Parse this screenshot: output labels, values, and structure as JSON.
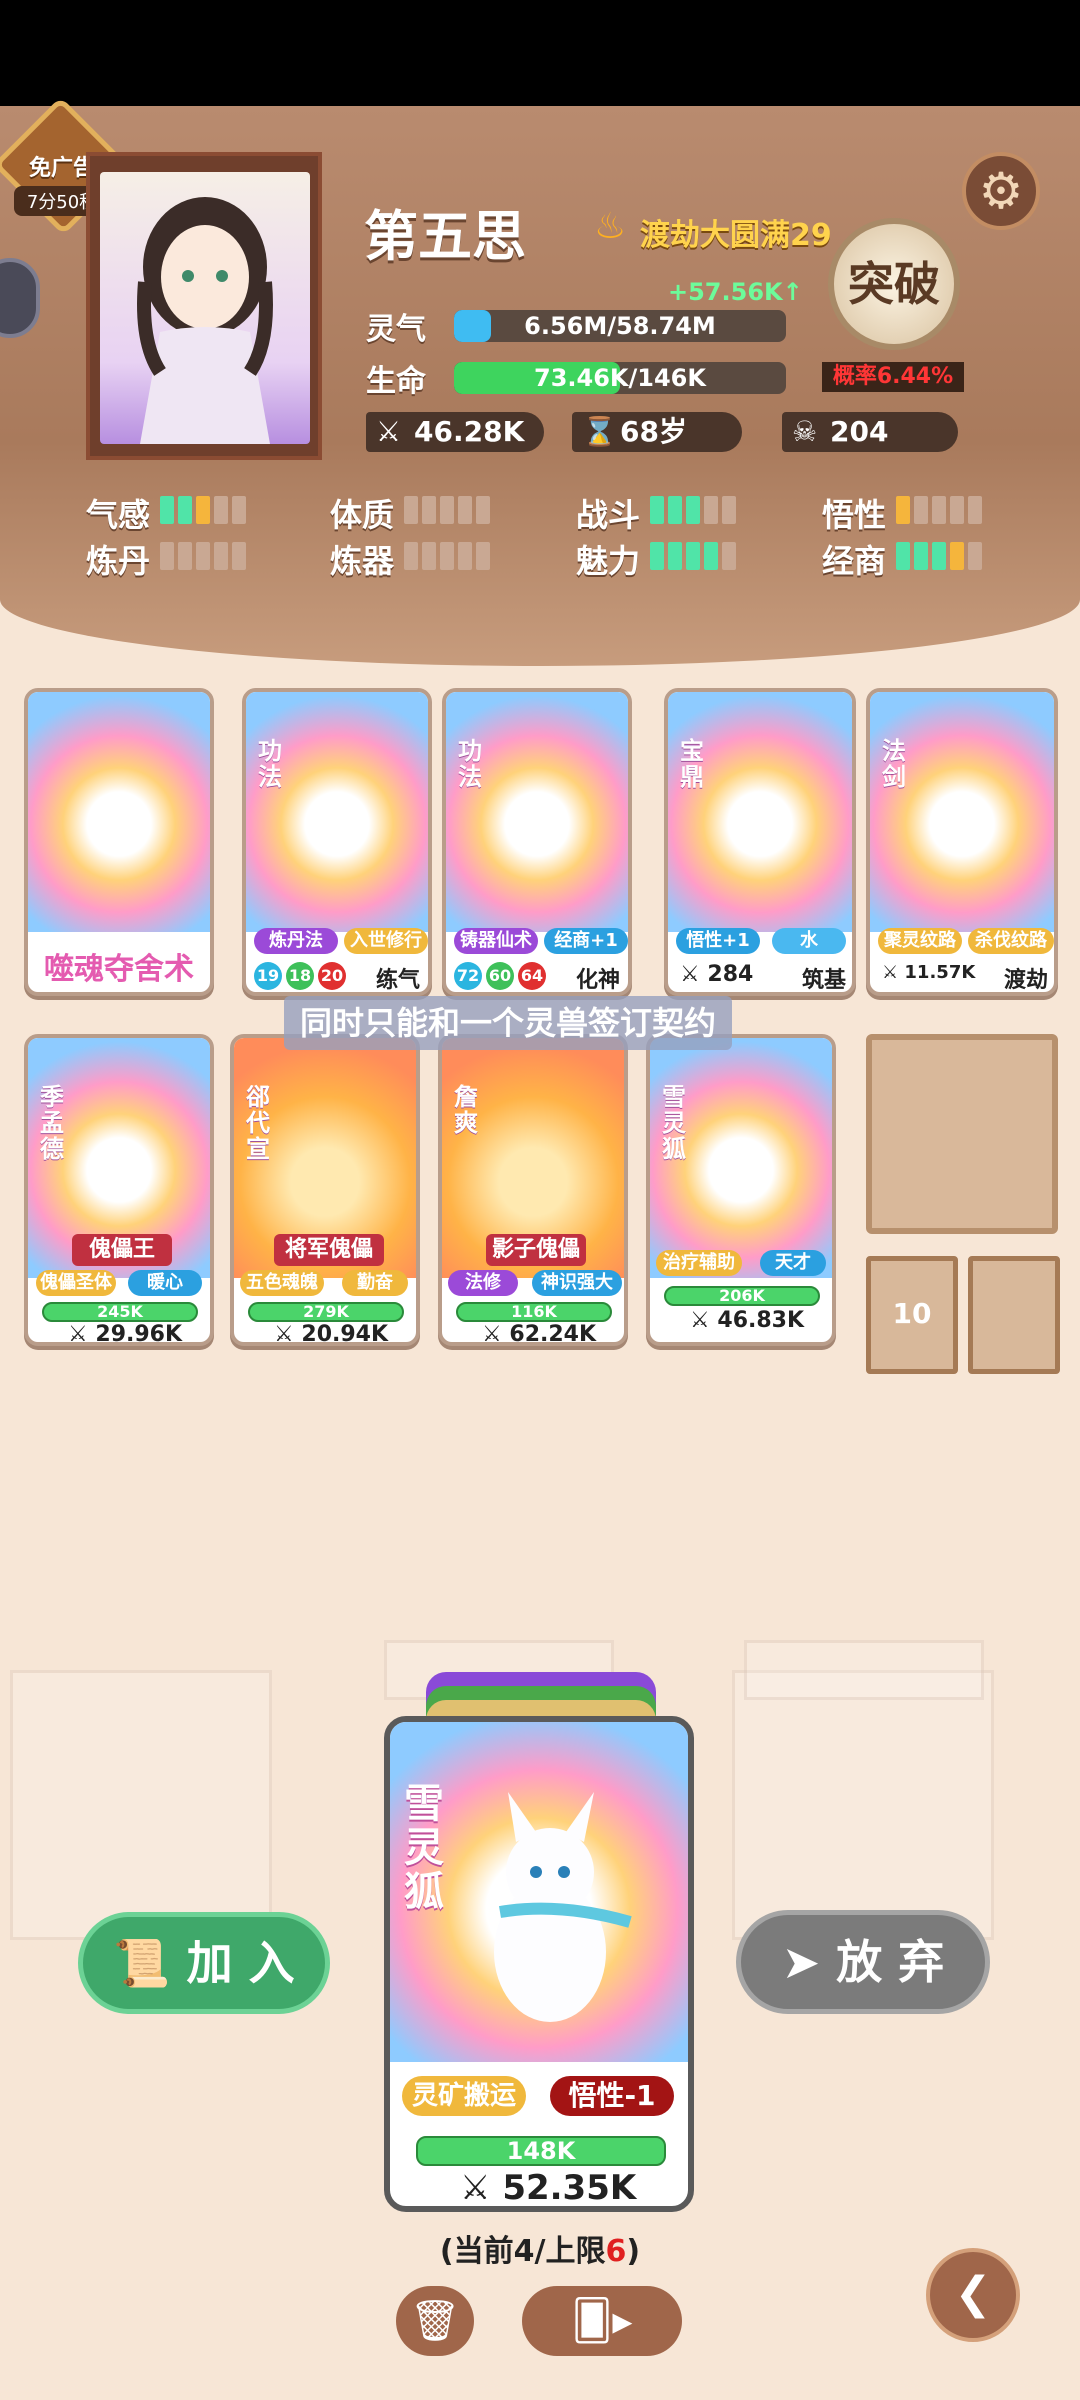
{
  "ad_badge": {
    "label": "免广告",
    "timer": "7分50秒"
  },
  "player": {
    "name": "第五思",
    "realm": "渡劫大圆满29",
    "gain": "+57.56K↑",
    "lingqi_label": "灵气",
    "lingqi_value": "6.56M/58.74M",
    "lingqi_fraction": 0.11,
    "life_label": "生命",
    "life_value": "73.46K/146K",
    "life_fraction": 0.5,
    "power": "46.28K",
    "age": "68岁",
    "kills": "204",
    "breakthrough": "突破",
    "rate": "概率6.44%"
  },
  "attributes": [
    {
      "label": "气感",
      "pips": [
        "g",
        "g",
        "y",
        "e",
        "e"
      ]
    },
    {
      "label": "体质",
      "pips": [
        "e",
        "e",
        "e",
        "e",
        "e"
      ]
    },
    {
      "label": "战斗",
      "pips": [
        "g",
        "g",
        "g",
        "e",
        "e"
      ]
    },
    {
      "label": "悟性",
      "pips": [
        "y",
        "e",
        "e",
        "e",
        "e"
      ]
    },
    {
      "label": "炼丹",
      "pips": [
        "e",
        "e",
        "e",
        "e",
        "e"
      ]
    },
    {
      "label": "炼器",
      "pips": [
        "e",
        "e",
        "e",
        "e",
        "e"
      ]
    },
    {
      "label": "魅力",
      "pips": [
        "g",
        "g",
        "g",
        "g",
        "e"
      ]
    },
    {
      "label": "经商",
      "pips": [
        "g",
        "g",
        "g",
        "y",
        "e"
      ]
    }
  ],
  "skill_cards": [
    {
      "type": "",
      "title": "噬魂夺舍术"
    },
    {
      "type": "功法",
      "tags": [
        "炼丹法",
        "入世修行"
      ],
      "nums": [
        "19",
        "18",
        "20"
      ],
      "level": "练气"
    },
    {
      "type": "功法",
      "tags": [
        "铸器仙术",
        "经商+1"
      ],
      "nums": [
        "72",
        "60",
        "64"
      ],
      "level": "化神"
    },
    {
      "type": "宝鼎",
      "tags": [
        "悟性+1",
        "水"
      ],
      "power": "284",
      "level": "筑基"
    },
    {
      "type": "法剑",
      "tags": [
        "聚灵纹路",
        "杀伐纹路"
      ],
      "power": "11.57K",
      "level": "渡劫"
    }
  ],
  "beast_cards": [
    {
      "name": "季孟德",
      "role": "傀儡王",
      "tags": [
        "傀儡圣体",
        "暖心"
      ],
      "hp": "245K",
      "power": "29.96K"
    },
    {
      "name": "郤代宣",
      "role": "将军傀儡",
      "tags": [
        "五色魂魄",
        "勤奋"
      ],
      "hp": "279K",
      "power": "20.94K"
    },
    {
      "name": "詹爽",
      "role": "影子傀儡",
      "tags": [
        "法修",
        "神识强大"
      ],
      "hp": "116K",
      "power": "62.24K"
    },
    {
      "name": "雪灵狐",
      "role": "",
      "tags": [
        "治疗辅助",
        "天才"
      ],
      "hp": "206K",
      "power": "46.83K"
    }
  ],
  "tooltip": "同时只能和一个灵兽签订契约",
  "slot_count": "10",
  "main_card": {
    "name": "雪灵狐",
    "tags": [
      "灵矿搬运",
      "悟性-1"
    ],
    "hp": "148K",
    "power": "52.35K"
  },
  "buttons": {
    "join": "加 入",
    "quit": "放 弃"
  },
  "count": {
    "prefix": "(当前4/上限",
    "limit": "6",
    "suffix": ")"
  }
}
